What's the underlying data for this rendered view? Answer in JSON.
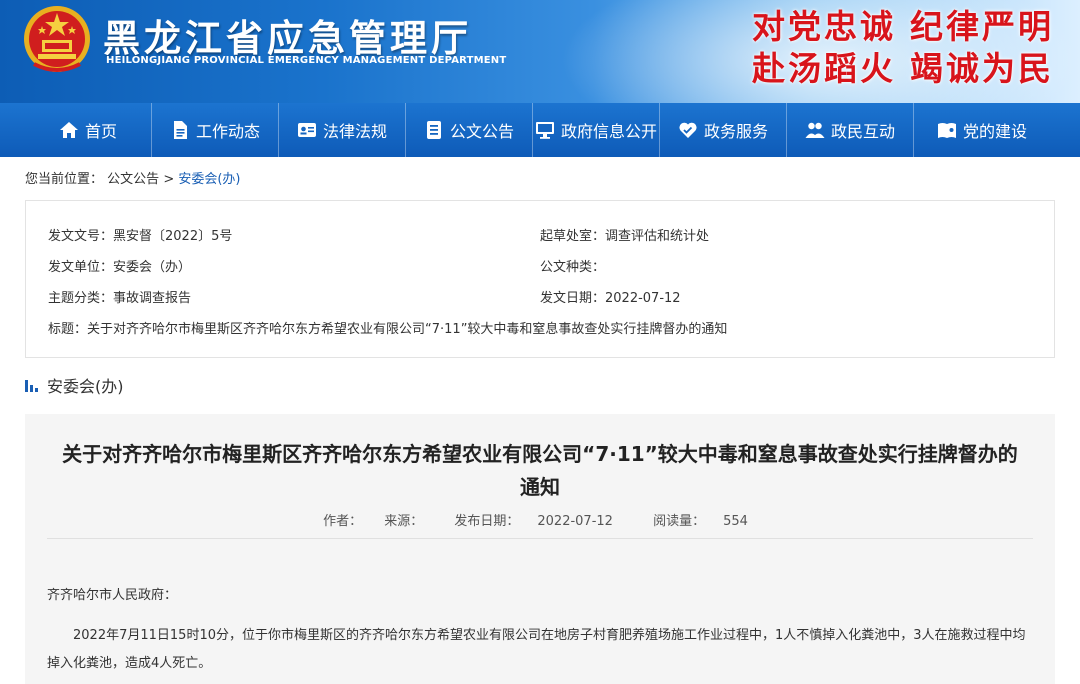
{
  "header": {
    "title": "黑龙江省应急管理厅",
    "subtitle": "HEILONGJIANG PROVINCIAL EMERGENCY MANAGEMENT DEPARTMENT",
    "slogan_line1": [
      "对党忠诚",
      "纪律严明"
    ],
    "slogan_line2": [
      "赴汤蹈火",
      "竭诚为民"
    ],
    "emblem_icon": "national-emblem-icon"
  },
  "nav": {
    "items": [
      {
        "label": "首页",
        "icon": "home-icon"
      },
      {
        "label": "工作动态",
        "icon": "document-icon"
      },
      {
        "label": "法律法规",
        "icon": "id-card-icon"
      },
      {
        "label": "公文公告",
        "icon": "list-icon"
      },
      {
        "label": "政府信息公开",
        "icon": "monitor-icon"
      },
      {
        "label": "政务服务",
        "icon": "heart-icon"
      },
      {
        "label": "政民互动",
        "icon": "people-icon"
      },
      {
        "label": "党的建设",
        "icon": "party-book-icon"
      }
    ]
  },
  "breadcrumb": {
    "prefix": "您当前位置：",
    "level1": "公文公告",
    "sep": ">",
    "current": "安委会(办)"
  },
  "meta": {
    "doc_no_label": "发文文号：",
    "doc_no": "黑安督〔2022〕5号",
    "drafting_office_label": "起草处室：",
    "drafting_office": "调查评估和统计处",
    "issuer_label": "发文单位：",
    "issuer": "安委会（办）",
    "doc_type_label": "公文种类：",
    "doc_type": "",
    "topic_label": "主题分类：",
    "topic": "事故调查报告",
    "date_label": "发文日期：",
    "date": "2022-07-12",
    "title_label": "标题：",
    "title": "关于对齐齐哈尔市梅里斯区齐齐哈尔东方希望农业有限公司“7·11”较大中毒和窒息事故查处实行挂牌督办的通知"
  },
  "section": {
    "heading": "安委会(办)"
  },
  "article": {
    "title": "关于对齐齐哈尔市梅里斯区齐齐哈尔东方希望农业有限公司“7·11”较大中毒和窒息事故查处实行挂牌督办的通知",
    "author_label": "作者：",
    "source_label": "来源：",
    "date_label": "发布日期：",
    "date": "2022-07-12",
    "views_label": "阅读量：",
    "views": "554",
    "salutation": "齐齐哈尔市人民政府：",
    "body": "2022年7月11日15时10分，位于你市梅里斯区的齐齐哈尔东方希望农业有限公司在地房子村育肥养殖场施工作业过程中，1人不慎掉入化粪池中，3人在施救过程中均掉入化粪池，造成4人死亡。"
  },
  "colors": {
    "nav_blue": "#0e5bb8",
    "slogan_red": "#d8141b",
    "link_blue": "#1a5fb4"
  }
}
